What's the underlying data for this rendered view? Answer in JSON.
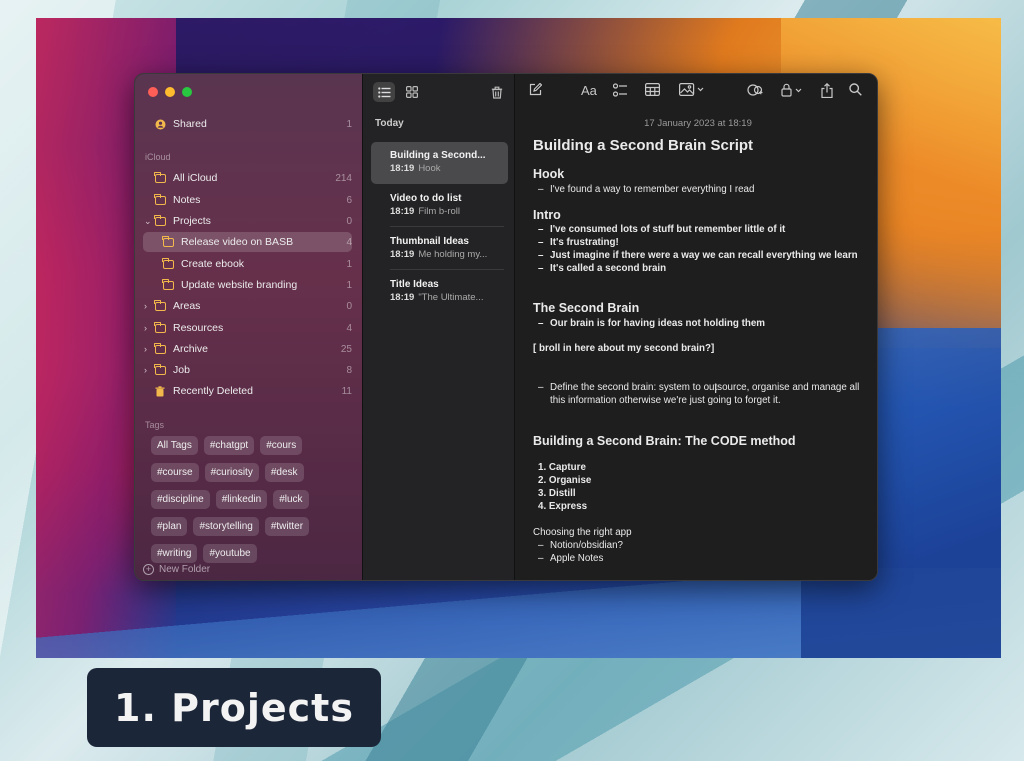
{
  "sidebar": {
    "shared": {
      "label": "Shared",
      "count": "1"
    },
    "icloud_header": "iCloud",
    "items": [
      {
        "label": "All iCloud",
        "count": "214"
      },
      {
        "label": "Notes",
        "count": "6"
      },
      {
        "label": "Projects",
        "count": "0"
      },
      {
        "label": "Release video on BASB",
        "count": "4"
      },
      {
        "label": "Create ebook",
        "count": "1"
      },
      {
        "label": "Update website branding",
        "count": "1"
      },
      {
        "label": "Areas",
        "count": "0"
      },
      {
        "label": "Resources",
        "count": "4"
      },
      {
        "label": "Archive",
        "count": "25"
      },
      {
        "label": "Job",
        "count": "8"
      },
      {
        "label": "Recently Deleted",
        "count": "11"
      }
    ],
    "tags_header": "Tags",
    "tags": [
      "All Tags",
      "#chatgpt",
      "#cours",
      "#course",
      "#curiosity",
      "#desk",
      "#discipline",
      "#linkedin",
      "#luck",
      "#plan",
      "#storytelling",
      "#twitter",
      "#writing",
      "#youtube"
    ],
    "new_folder": "New Folder"
  },
  "note_list": {
    "section": "Today",
    "notes": [
      {
        "title": "Building a Second...",
        "time": "18:19",
        "preview": "Hook"
      },
      {
        "title": "Video to do list",
        "time": "18:19",
        "preview": "Film b-roll"
      },
      {
        "title": "Thumbnail Ideas",
        "time": "18:19",
        "preview": "Me holding my..."
      },
      {
        "title": "Title Ideas",
        "time": "18:19",
        "preview": "\"The Ultimate..."
      }
    ]
  },
  "editor": {
    "date": "17 January 2023 at 18:19",
    "title": "Building a Second Brain Script",
    "hook_heading": "Hook",
    "hook_bullets": [
      "I've found a way to remember everything I read"
    ],
    "intro_heading": "Intro",
    "intro_bullets": [
      "I've consumed lots of stuff but remember little of it",
      "It's frustrating!",
      "Just imagine if there were a way we can recall everything we learn",
      "It's called a second brain"
    ],
    "second_brain_heading": "The Second Brain",
    "second_brain_bullets": [
      "Our brain is for having ideas not holding them"
    ],
    "broll_note": "[ broll in here about my second brain?]",
    "define_bullet": "Define the second brain:  system to outsource, organise and manage all this information otherwise we're just going to forget it.",
    "code_heading": "Building a Second Brain: The CODE method",
    "code_steps": [
      "1. Capture",
      "2. Organise",
      "3. Distill",
      "4. Express"
    ],
    "app_heading": "Choosing the right app",
    "app_bullets": [
      "Notion/obsidian?",
      "Apple Notes"
    ]
  },
  "caption": "1. Projects"
}
